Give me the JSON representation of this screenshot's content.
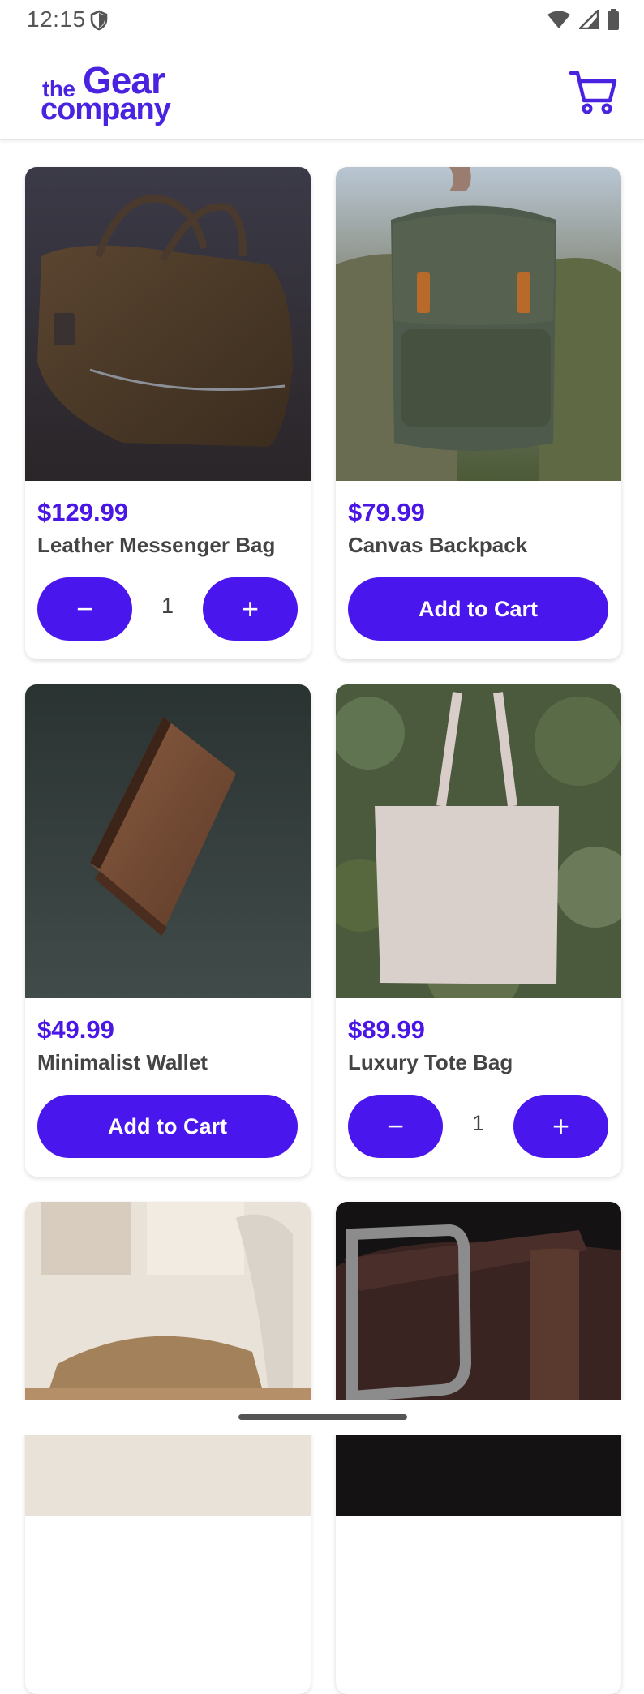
{
  "status_bar": {
    "time": "12:15"
  },
  "header": {
    "logo": {
      "the": "the",
      "gear": "Gear",
      "company": "company"
    },
    "cart_icon": "shopping-cart-icon"
  },
  "colors": {
    "accent": "#4a16ee",
    "price": "#4a16e6",
    "text": "#444444"
  },
  "products": [
    {
      "price": "$129.99",
      "name": "Leather Messenger Bag",
      "in_cart": true,
      "quantity": "1",
      "minus": "−",
      "plus": "+"
    },
    {
      "price": "$79.99",
      "name": "Canvas Backpack",
      "in_cart": false,
      "add_label": "Add to Cart"
    },
    {
      "price": "$49.99",
      "name": "Minimalist Wallet",
      "in_cart": false,
      "add_label": "Add to Cart"
    },
    {
      "price": "$89.99",
      "name": "Luxury Tote Bag",
      "in_cart": true,
      "quantity": "1",
      "minus": "−",
      "plus": "+"
    }
  ]
}
